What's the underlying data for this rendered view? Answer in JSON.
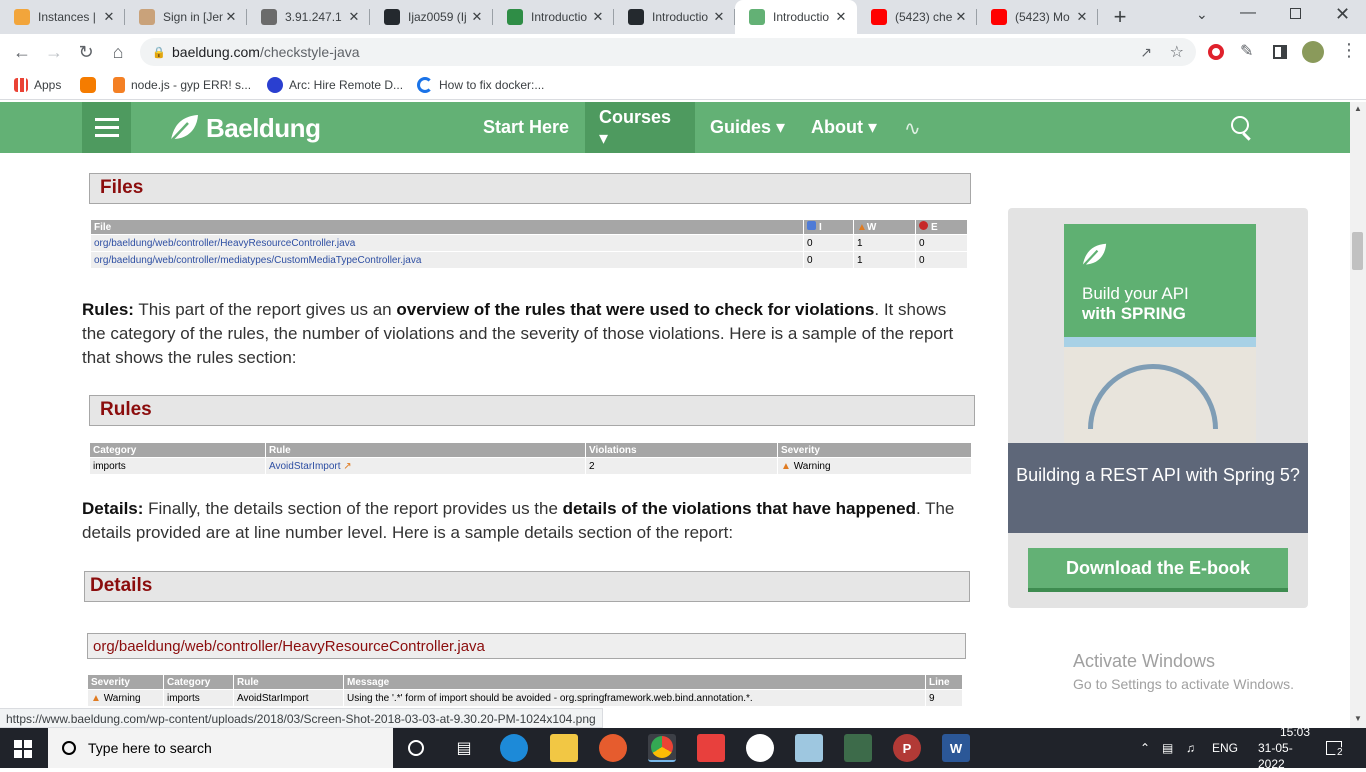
{
  "browser": {
    "tabs": [
      {
        "title": "Instances | ",
        "icon": "aws-box-icon",
        "color": "#f2a53b"
      },
      {
        "title": "Sign in [Jen",
        "icon": "jenkins-icon",
        "color": "#c9a27a"
      },
      {
        "title": "3.91.247.1",
        "icon": "graph-icon",
        "color": "#6b6b6b"
      },
      {
        "title": "Ijaz0059 (Ij",
        "icon": "github-icon",
        "color": "#24292e"
      },
      {
        "title": "Introductio",
        "icon": "link-icon",
        "color": "#2f8d46"
      },
      {
        "title": "Introductio",
        "icon": "github-icon",
        "color": "#24292e"
      },
      {
        "title": "Introductio",
        "icon": "baeldung-icon",
        "color": "#63b175",
        "active": true
      },
      {
        "title": "(5423) che",
        "icon": "youtube-icon",
        "color": "#ff0000"
      },
      {
        "title": "(5423) Mo",
        "icon": "youtube-icon",
        "color": "#ff0000"
      }
    ],
    "new_tab": "+",
    "url_host": "baeldung.com",
    "url_path": "/checkstyle-java",
    "bookmarks": [
      {
        "label": "Apps",
        "icon": "apps-grid-icon"
      },
      {
        "label": "",
        "icon": "hexagon-icon"
      },
      {
        "label": "node.js - gyp ERR! s...",
        "icon": "stack-icon"
      },
      {
        "label": "Arc: Hire Remote D...",
        "icon": "arc-icon"
      },
      {
        "label": "How to fix docker:...",
        "icon": "refresh-icon"
      }
    ]
  },
  "site": {
    "logo": "Baeldung",
    "nav": [
      "Start Here",
      "Courses ▾",
      "Guides ▾",
      "About ▾"
    ]
  },
  "article": {
    "files_panel": {
      "heading": "Files",
      "headers": [
        "File",
        "I",
        "W",
        "E"
      ],
      "rows": [
        [
          "org/baeldung/web/controller/HeavyResourceController.java",
          "0",
          "1",
          "0"
        ],
        [
          "org/baeldung/web/controller/mediatypes/CustomMediaTypeController.java",
          "0",
          "1",
          "0"
        ]
      ]
    },
    "rules_para": {
      "b1": "Rules:",
      "t1": " This part of the report gives us an ",
      "b2": "overview of the rules that were used to check for violations",
      "t2": ". It shows the category of the rules, the number of violations and the severity of those violations. Here is a sample of the report that shows the rules section:"
    },
    "rules_panel": {
      "heading": "Rules",
      "headers": [
        "Category",
        "Rule",
        "Violations",
        "Severity"
      ],
      "row": [
        "imports",
        "AvoidStarImport",
        "2",
        "Warning"
      ]
    },
    "details_para": {
      "b1": "Details:",
      "t1": " Finally, the details section of the report provides us the ",
      "b2": "details of the violations that have happened",
      "t2": ". The details provided are at line number level. Here is a sample details section of the report:"
    },
    "details_panel": {
      "heading": "Details",
      "file": "org/baeldung/web/controller/HeavyResourceController.java",
      "headers": [
        "Severity",
        "Category",
        "Rule",
        "Message",
        "Line"
      ],
      "row": [
        "Warning",
        "imports",
        "AvoidStarImport",
        "Using the '.*' form of import should be avoided - org.springframework.web.bind.annotation.*.",
        "9"
      ]
    }
  },
  "sidebar": {
    "cover_line1": "Build your API",
    "cover_line2": "with SPRING",
    "promo": "Building a REST API with Spring 5?",
    "button": "Download the E-book"
  },
  "watermark": {
    "title": "Activate Windows",
    "subtitle": "Go to Settings to activate Windows."
  },
  "status_url": "https://www.baeldung.com/wp-content/uploads/2018/03/Screen-Shot-2018-03-03-at-9.30.20-PM-1024x104.png",
  "taskbar": {
    "search_placeholder": "Type here to search",
    "lang": "ENG",
    "time": "15:03",
    "date": "31-05-2022",
    "notifications": "2"
  }
}
